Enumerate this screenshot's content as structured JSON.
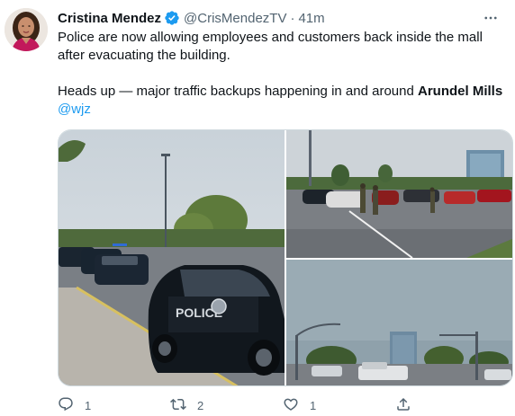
{
  "tweet": {
    "author_name": "Cristina Mendez",
    "handle": "@CrisMendezTV",
    "separator": "·",
    "time": "41m",
    "text_line1": "Police are now allowing employees and customers back inside the mall after evacuating the building.",
    "text_line2_prefix": "Heads up — major traffic backups happening in and around ",
    "text_line2_bold": "Arundel Mills",
    "mention": "@wjz",
    "verified_color": "#1d9bf0",
    "media": [
      {
        "icon": "police-car-parking-lot-photo",
        "police_door_text": "POLICE"
      },
      {
        "icon": "officers-in-parking-lot-photo"
      },
      {
        "icon": "parking-lot-street-lights-photo"
      }
    ],
    "actions": {
      "reply_count": "1",
      "retweet_count": "2",
      "like_count": "1",
      "share_count": ""
    }
  }
}
